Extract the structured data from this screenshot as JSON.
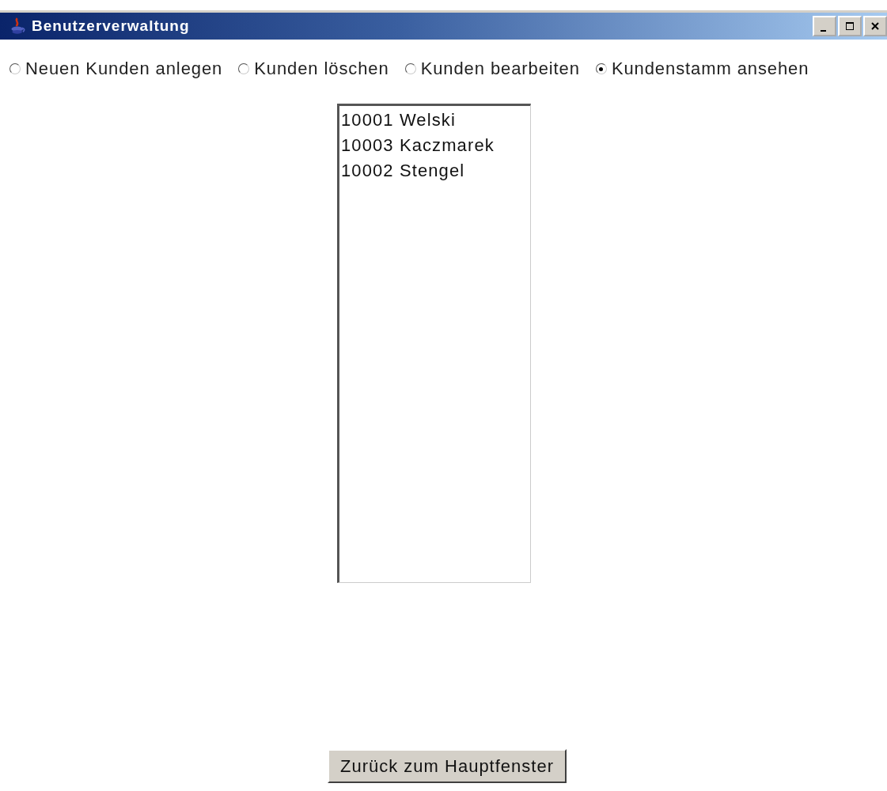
{
  "window": {
    "title": "Benutzerverwaltung"
  },
  "options": [
    {
      "label": "Neuen Kunden anlegen",
      "selected": false
    },
    {
      "label": "Kunden löschen",
      "selected": false
    },
    {
      "label": "Kunden bearbeiten",
      "selected": false
    },
    {
      "label": "Kundenstamm ansehen",
      "selected": true
    }
  ],
  "customer_list": [
    "10001 Welski",
    "10003 Kaczmarek",
    "10002 Stengel"
  ],
  "back_button": "Zurück zum Hauptfenster"
}
